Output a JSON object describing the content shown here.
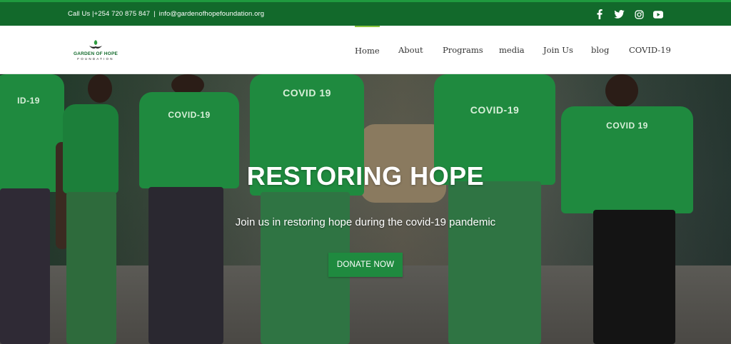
{
  "topbar": {
    "phone": "Call Us |+254 720 875 847",
    "separator": "|",
    "email": "info@gardenofhopefoundation.org",
    "social": [
      "facebook-icon",
      "twitter-icon",
      "instagram-icon",
      "youtube-icon"
    ]
  },
  "logo": {
    "name": "GARDEN OF HOPE",
    "subtitle": "FOUNDATION"
  },
  "nav": {
    "items": [
      {
        "label": "Home"
      },
      {
        "label": "About"
      },
      {
        "label": "Programs"
      },
      {
        "label": "media"
      },
      {
        "label": "Join Us"
      },
      {
        "label": "blog"
      },
      {
        "label": "COVID-19"
      }
    ],
    "active_color": "#8dc63f"
  },
  "hero": {
    "title": "RESTORING HOPE",
    "subtitle": "Join us in restoring hope during the covid-19 pandemic",
    "cta": "DONATE NOW",
    "shirt_texts": [
      "ID-19",
      "COVID-19",
      "COVID 19",
      "COVID-19",
      "COVID 19",
      "COVID 19"
    ]
  },
  "colors": {
    "brand_green": "#12692b",
    "button_green": "#1f8a3f",
    "accent": "#8dc63f"
  }
}
